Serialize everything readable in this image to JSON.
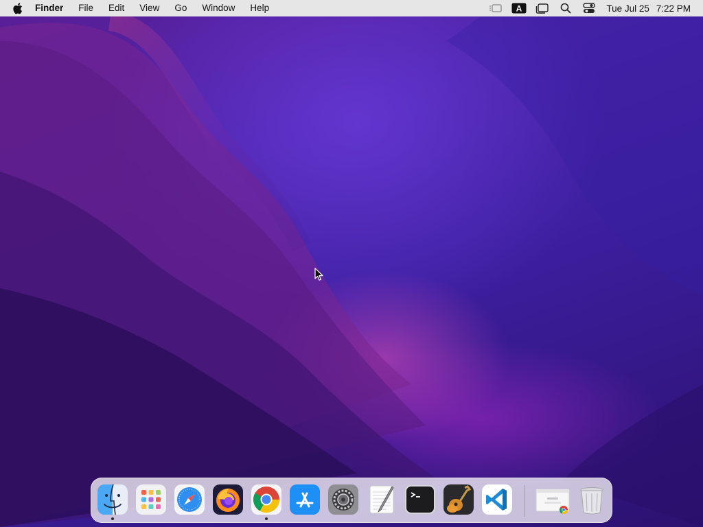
{
  "menubar": {
    "apple_icon": "apple-logo-icon",
    "app_name": "Finder",
    "menus": [
      "File",
      "Edit",
      "View",
      "Go",
      "Window",
      "Help"
    ],
    "status_icons": [
      "screen-mirroring-icon",
      "input-source-icon",
      "stage-manager-icon",
      "spotlight-search-icon",
      "control-center-icon"
    ],
    "input_source_label": "A",
    "clock": {
      "date": "Tue Jul 25",
      "time": "7:22 PM"
    }
  },
  "dock": {
    "apps": [
      {
        "name": "Finder",
        "icon": "finder-icon",
        "running": true
      },
      {
        "name": "Launchpad",
        "icon": "launchpad-icon",
        "running": false
      },
      {
        "name": "Safari",
        "icon": "safari-icon",
        "running": false
      },
      {
        "name": "Firefox",
        "icon": "firefox-icon",
        "running": false
      },
      {
        "name": "Google Chrome",
        "icon": "chrome-icon",
        "running": true
      },
      {
        "name": "App Store",
        "icon": "app-store-icon",
        "running": false
      },
      {
        "name": "System Settings",
        "icon": "system-settings-icon",
        "running": false
      },
      {
        "name": "TextEdit",
        "icon": "textedit-icon",
        "running": false
      },
      {
        "name": "Terminal",
        "icon": "terminal-icon",
        "running": false
      },
      {
        "name": "GarageBand",
        "icon": "garageband-icon",
        "running": false
      },
      {
        "name": "Visual Studio Code",
        "icon": "vscode-icon",
        "running": false
      }
    ],
    "extras": [
      {
        "name": "Chrome window",
        "icon": "minimized-chrome-window-icon"
      },
      {
        "name": "Trash",
        "icon": "trash-icon"
      }
    ]
  },
  "colors": {
    "menubar_bg": "#e6e6e6",
    "wallpaper_main": "#4a22a8",
    "wallpaper_glow": "#e650be"
  }
}
